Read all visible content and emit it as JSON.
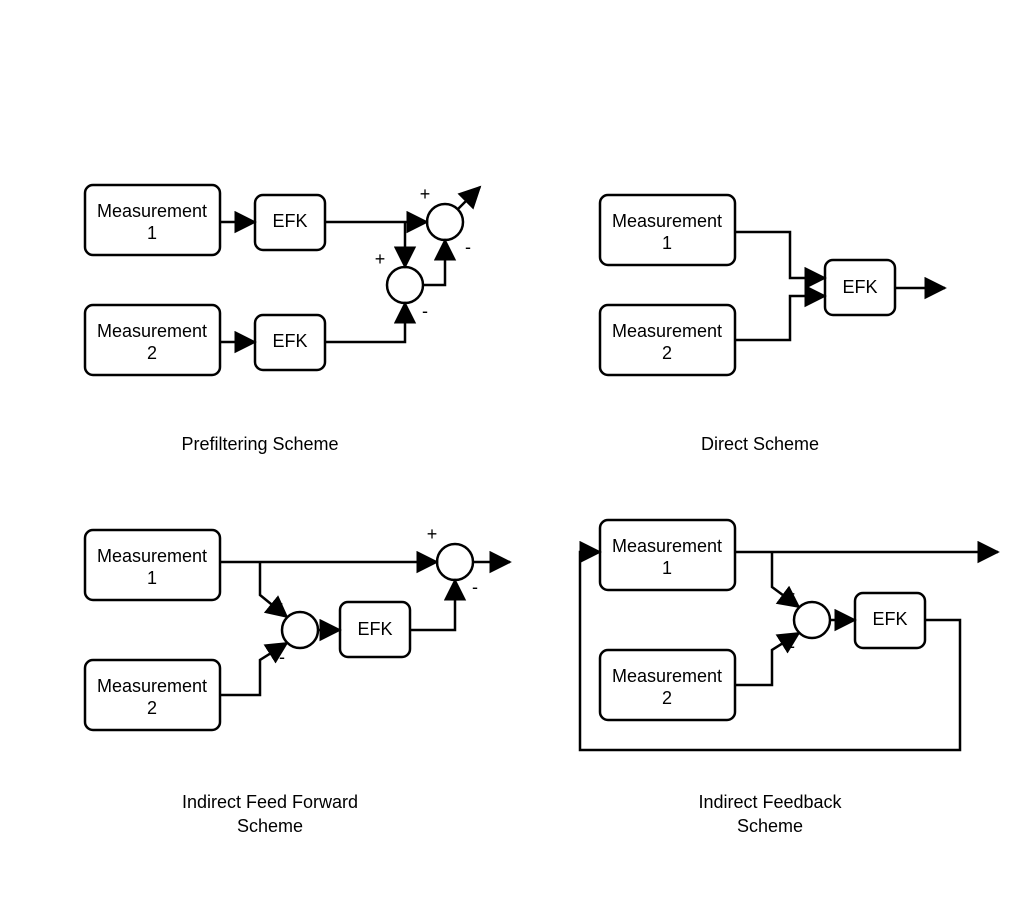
{
  "labels": {
    "meas1": "Measurement",
    "meas1_n": "1",
    "meas2": "Measurement",
    "meas2_n": "2",
    "efk": "EFK",
    "plus": "+",
    "minus": "-"
  },
  "captions": {
    "prefilter": "Prefiltering Scheme",
    "direct": "Direct Scheme",
    "iff_l1": "Indirect Feed Forward",
    "iff_l2": "Scheme",
    "ifb_l1": "Indirect Feedback",
    "ifb_l2": "Scheme"
  }
}
